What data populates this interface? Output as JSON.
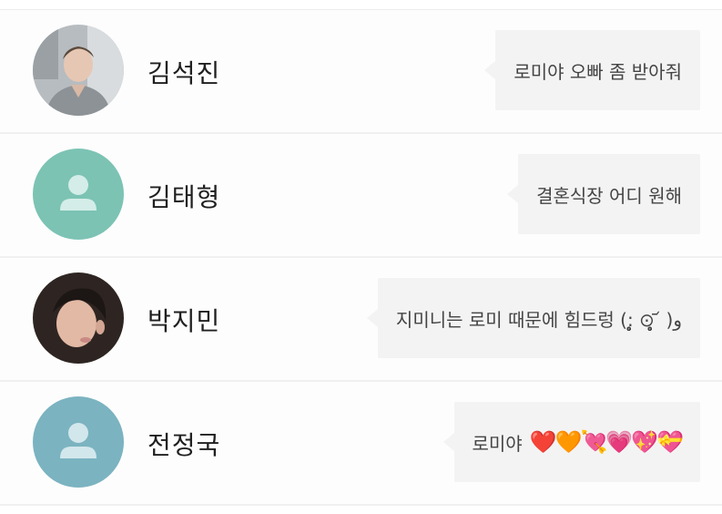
{
  "contacts": [
    {
      "name": "김석진",
      "message": "로미야 오빠 좀 받아줘",
      "avatar": "photo",
      "avatar_color": "#8a8f93"
    },
    {
      "name": "김태형",
      "message": "결혼식장 어디 원해",
      "avatar": "default-person-icon",
      "avatar_color": "#7cc3b4"
    },
    {
      "name": "박지민",
      "message": "지미니는 로미 때문에 힘드렁 (:̥̥̥̥̥̥̥̥̥̥̥̥̥̥̥̥̥̥̥̥̥̥̥̥̥̥̥̥̥̥̥̥̥̥̥̥̥̥̥̥̥̥̥̥̥̥̥̥̥̥ ⊙̥̥̥̥̥̥̥̥̥̥̥̥̥̥̥̥̥̥̥̥̥̥̥̥̥̥̥̥̥̥̥̥̥ ᷄ )و",
      "avatar": "photo",
      "avatar_color": "#5b4a44"
    },
    {
      "name": "전정국",
      "message": "로미야",
      "hearts": "❤️🧡💘💗💖💝",
      "avatar": "default-person-icon",
      "avatar_color": "#7bb3c0"
    }
  ],
  "colors": {
    "bubble_bg": "#f3f3f3",
    "row_bg": "#fdfdfd",
    "divider": "#f0f0f0"
  }
}
